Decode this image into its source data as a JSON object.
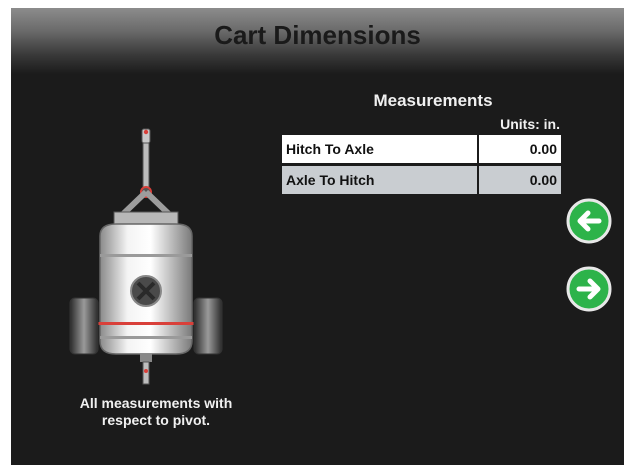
{
  "header": {
    "title": "Cart Dimensions"
  },
  "measurements": {
    "title": "Measurements",
    "units_label": "Units: in.",
    "rows": [
      {
        "label": "Hitch To Axle",
        "value": "0.00"
      },
      {
        "label": "Axle To Hitch",
        "value": "0.00"
      }
    ]
  },
  "note": {
    "line1": "All measurements with",
    "line2": "respect to pivot."
  },
  "navigation": {
    "back_icon": "left-arrow-icon",
    "forward_icon": "right-arrow-icon",
    "accent": "#2db34a"
  },
  "illustration": {
    "icon": "grain-cart-icon",
    "highlight": "#d9403a"
  }
}
